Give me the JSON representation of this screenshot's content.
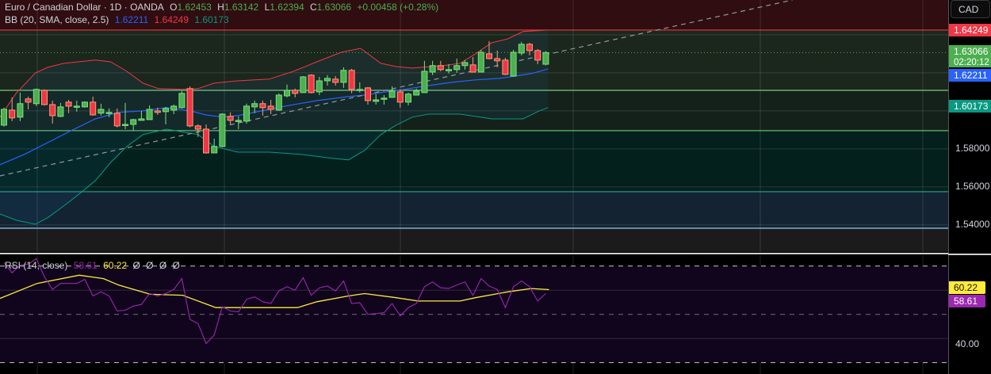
{
  "header": {
    "symbol": "Euro / Canadian Dollar · 1D · OANDA",
    "open_label": "O",
    "open": "1.62453",
    "high_label": "H",
    "high": "1.63142",
    "low_label": "L",
    "low": "1.62394",
    "close_label": "C",
    "close": "1.63066",
    "change": "+0.00458 (+0.28%)"
  },
  "bb_legend": {
    "label": "BB (20, SMA, close, 2.5)",
    "basis": "1.62211",
    "upper": "1.64249",
    "lower": "1.60173"
  },
  "rsi_legend": {
    "label": "RSI (14, close)",
    "rsi": "58.61",
    "ma": "60.22",
    "extras": [
      "Ø",
      "Ø",
      "Ø",
      "Ø"
    ]
  },
  "price_axis": {
    "currency_button": "CAD",
    "ticks": [
      "1.58000",
      "1.56000",
      "1.54000"
    ],
    "upper_badge": "1.64249",
    "last_price_badge": "1.63066",
    "countdown": "02:20:12",
    "basis_badge": "1.62211",
    "lower_badge": "1.60173"
  },
  "rsi_axis": {
    "ticks": [
      "40.00"
    ],
    "ma_badge": "60.22",
    "rsi_badge": "58.61"
  },
  "colors": {
    "up": "#4caf50",
    "down": "#f23645",
    "basis": "#2962ff",
    "upper": "#f23645",
    "lower": "#089981",
    "rsi": "#9c27b0",
    "rsi_ma": "#ffeb3b"
  },
  "chart_data": [
    {
      "type": "candlestick",
      "title": "Euro / Canadian Dollar · 1D · OANDA",
      "ylim": [
        1.5258,
        1.6583
      ],
      "y_ticks": [
        1.54,
        1.56,
        1.58
      ],
      "grid": true,
      "ohlc": [
        [
          1.5925,
          1.6017,
          1.5917,
          1.6008
        ],
        [
          1.6004,
          1.6071,
          1.5946,
          1.5963
        ],
        [
          1.5967,
          1.6096,
          1.5946,
          1.6038
        ],
        [
          1.6063,
          1.6075,
          1.6008,
          1.6046
        ],
        [
          1.6038,
          1.6117,
          1.6025,
          1.6113
        ],
        [
          1.6108,
          1.6113,
          1.6029,
          1.6033
        ],
        [
          1.6033,
          1.6054,
          1.5933,
          1.5975
        ],
        [
          1.5971,
          1.6042,
          1.5967,
          1.6021
        ],
        [
          1.6046,
          1.6058,
          1.5988,
          1.6025
        ],
        [
          1.6025,
          1.6054,
          1.5996,
          1.6025
        ],
        [
          1.6021,
          1.605,
          1.6017,
          1.6046
        ],
        [
          1.6046,
          1.6075,
          1.5975,
          1.5979
        ],
        [
          1.5988,
          1.6038,
          1.5975,
          1.6008
        ],
        [
          1.5992,
          1.6013,
          1.5967,
          1.5992
        ],
        [
          1.5988,
          1.6013,
          1.5913,
          1.5921
        ],
        [
          1.5925,
          1.6042,
          1.5904,
          1.5929
        ],
        [
          1.5929,
          1.5958,
          1.5896,
          1.5954
        ],
        [
          1.595,
          1.6,
          1.595,
          1.5958
        ],
        [
          1.5954,
          1.6029,
          1.5954,
          1.6008
        ],
        [
          1.6,
          1.6017,
          1.5979,
          1.5992
        ],
        [
          1.5996,
          1.6021,
          1.5929,
          1.6013
        ],
        [
          1.6004,
          1.6033,
          1.5983,
          1.6025
        ],
        [
          1.6017,
          1.6104,
          1.6013,
          1.6092
        ],
        [
          1.6117,
          1.6129,
          1.5913,
          1.5921
        ],
        [
          1.5921,
          1.5929,
          1.5863,
          1.5904
        ],
        [
          1.5904,
          1.5929,
          1.5775,
          1.5779
        ],
        [
          1.5779,
          1.5854,
          1.5779,
          1.5813
        ],
        [
          1.5813,
          1.5988,
          1.5808,
          1.5983
        ],
        [
          1.5971,
          1.5992,
          1.5929,
          1.595
        ],
        [
          1.595,
          1.5971,
          1.5904,
          1.595
        ],
        [
          1.5946,
          1.6038,
          1.5933,
          1.6025
        ],
        [
          1.6021,
          1.6054,
          1.5988,
          1.6038
        ],
        [
          1.6038,
          1.6054,
          1.5975,
          1.6017
        ],
        [
          1.6025,
          1.6058,
          1.5983,
          1.6008
        ],
        [
          1.6004,
          1.6092,
          1.6,
          1.6083
        ],
        [
          1.6079,
          1.6138,
          1.6071,
          1.6108
        ],
        [
          1.6108,
          1.6117,
          1.6071,
          1.6092
        ],
        [
          1.6096,
          1.6183,
          1.6096,
          1.6179
        ],
        [
          1.6188,
          1.6192,
          1.6092,
          1.6096
        ],
        [
          1.61,
          1.6179,
          1.6083,
          1.6158
        ],
        [
          1.6158,
          1.6188,
          1.6133,
          1.6171
        ],
        [
          1.6167,
          1.6183,
          1.6133,
          1.615
        ],
        [
          1.615,
          1.6229,
          1.6121,
          1.6213
        ],
        [
          1.6213,
          1.6221,
          1.6092,
          1.6113
        ],
        [
          1.6113,
          1.615,
          1.6096,
          1.6113
        ],
        [
          1.6121,
          1.6125,
          1.6033,
          1.6054
        ],
        [
          1.605,
          1.6088,
          1.6033,
          1.6058
        ],
        [
          1.6067,
          1.6083,
          1.6033,
          1.6067
        ],
        [
          1.6071,
          1.6129,
          1.6071,
          1.6104
        ],
        [
          1.61,
          1.6113,
          1.6017,
          1.6046
        ],
        [
          1.6046,
          1.6096,
          1.6029,
          1.6088
        ],
        [
          1.6083,
          1.6117,
          1.6083,
          1.6104
        ],
        [
          1.6096,
          1.6263,
          1.6096,
          1.6208
        ],
        [
          1.6204,
          1.6263,
          1.6188,
          1.6238
        ],
        [
          1.6238,
          1.6263,
          1.6208,
          1.6217
        ],
        [
          1.6217,
          1.6246,
          1.6196,
          1.6217
        ],
        [
          1.6217,
          1.6275,
          1.62,
          1.6238
        ],
        [
          1.6238,
          1.6267,
          1.6217,
          1.6254
        ],
        [
          1.6242,
          1.6283,
          1.6204,
          1.6204
        ],
        [
          1.6204,
          1.6321,
          1.6204,
          1.6308
        ],
        [
          1.63,
          1.6367,
          1.6271,
          1.6275
        ],
        [
          1.6275,
          1.6317,
          1.6229,
          1.6263
        ],
        [
          1.6267,
          1.6279,
          1.6188,
          1.6192
        ],
        [
          1.6183,
          1.6321,
          1.6179,
          1.6308
        ],
        [
          1.6304,
          1.6363,
          1.6292,
          1.635
        ],
        [
          1.635,
          1.6358,
          1.6292,
          1.6317
        ],
        [
          1.6317,
          1.6325,
          1.6246,
          1.6267
        ],
        [
          1.62453,
          1.63142,
          1.62394,
          1.63066
        ]
      ],
      "bb_upper": [
        [
          -0.5,
          1.5967
        ],
        [
          1.5,
          1.6092
        ],
        [
          3.9,
          1.62
        ],
        [
          5.4,
          1.6229
        ],
        [
          7.4,
          1.625
        ],
        [
          11.3,
          1.6267
        ],
        [
          13.2,
          1.6258
        ],
        [
          15.2,
          1.6208
        ],
        [
          17.2,
          1.6146
        ],
        [
          19.1,
          1.6117
        ],
        [
          22.1,
          1.6113
        ],
        [
          24,
          1.6117
        ],
        [
          26,
          1.6146
        ],
        [
          28.9,
          1.6158
        ],
        [
          32.8,
          1.6167
        ],
        [
          35.8,
          1.6208
        ],
        [
          38.7,
          1.6258
        ],
        [
          41.7,
          1.6308
        ],
        [
          44.1,
          1.6329
        ],
        [
          46.6,
          1.625
        ],
        [
          48.5,
          1.6233
        ],
        [
          50.5,
          1.6225
        ],
        [
          54.4,
          1.6238
        ],
        [
          56.4,
          1.625
        ],
        [
          58.3,
          1.63
        ],
        [
          60.3,
          1.6358
        ],
        [
          62.3,
          1.6379
        ],
        [
          64.2,
          1.6417
        ],
        [
          67.3,
          1.6425
        ]
      ],
      "bb_basis": [
        [
          -0.5,
          1.5717
        ],
        [
          2.5,
          1.5771
        ],
        [
          5.4,
          1.5833
        ],
        [
          8.3,
          1.5896
        ],
        [
          11.3,
          1.5958
        ],
        [
          14.2,
          1.5992
        ],
        [
          17.2,
          1.6
        ],
        [
          20.1,
          1.6017
        ],
        [
          23,
          1.6
        ],
        [
          25,
          1.5979
        ],
        [
          27,
          1.5967
        ],
        [
          28.9,
          1.5975
        ],
        [
          31.9,
          1.6
        ],
        [
          34.8,
          1.6025
        ],
        [
          38.7,
          1.6054
        ],
        [
          42.6,
          1.6075
        ],
        [
          44.6,
          1.6083
        ],
        [
          46.6,
          1.6096
        ],
        [
          49.5,
          1.6113
        ],
        [
          52.5,
          1.6133
        ],
        [
          55.4,
          1.615
        ],
        [
          58.3,
          1.6163
        ],
        [
          61.3,
          1.6171
        ],
        [
          63.2,
          1.6183
        ],
        [
          65.2,
          1.6196
        ],
        [
          67.3,
          1.6221
        ]
      ],
      "bb_lower": [
        [
          -0.5,
          1.5458
        ],
        [
          1.5,
          1.5425
        ],
        [
          3.9,
          1.5404
        ],
        [
          5.4,
          1.5438
        ],
        [
          7.4,
          1.55
        ],
        [
          9.3,
          1.5563
        ],
        [
          11.3,
          1.5633
        ],
        [
          13.2,
          1.5729
        ],
        [
          15.2,
          1.5813
        ],
        [
          17.2,
          1.5875
        ],
        [
          20.1,
          1.5904
        ],
        [
          24,
          1.5875
        ],
        [
          26,
          1.5813
        ],
        [
          28.9,
          1.5783
        ],
        [
          32.8,
          1.5783
        ],
        [
          36.8,
          1.5771
        ],
        [
          40.7,
          1.575
        ],
        [
          42.6,
          1.5742
        ],
        [
          44.6,
          1.5792
        ],
        [
          46.6,
          1.5875
        ],
        [
          48.5,
          1.5925
        ],
        [
          50.5,
          1.5967
        ],
        [
          52.5,
          1.5983
        ],
        [
          56.4,
          1.5983
        ],
        [
          58.3,
          1.5971
        ],
        [
          60.3,
          1.5958
        ],
        [
          64.2,
          1.5958
        ],
        [
          66.2,
          1.6
        ],
        [
          67.3,
          1.6017
        ]
      ],
      "horizontal_levels": [
        {
          "price": 1.64249,
          "color": "#f23645"
        },
        {
          "price": 1.6108,
          "color": "#81c784"
        },
        {
          "price": 1.5896,
          "color": "#66bb6a"
        },
        {
          "price": 1.5575,
          "color": "#26a69a"
        },
        {
          "price": 1.5383,
          "color": "#90caf9"
        }
      ],
      "zones": [
        {
          "from": 1.6583,
          "to": 1.64249,
          "color": "#2f0d10"
        },
        {
          "from": 1.64249,
          "to": 1.6108,
          "color": "#1b261c"
        },
        {
          "from": 1.6108,
          "to": 1.5896,
          "color": "#14211a"
        },
        {
          "from": 1.5896,
          "to": 1.5575,
          "color": "#04201c"
        },
        {
          "from": 1.5575,
          "to": 1.5383,
          "color": "#132331"
        },
        {
          "from": 1.5383,
          "to": 1.5258,
          "color": "#1b1b1b"
        }
      ],
      "trend_line": [
        [
          -0.5,
          1.5658
        ],
        [
          97.5,
          1.6583
        ]
      ],
      "last_price": 1.63066
    },
    {
      "type": "line",
      "title": "RSI (14, close)",
      "ylim": [
        25.3,
        74.5
      ],
      "bands": [
        70,
        50,
        30
      ],
      "grid_levels": [
        60,
        40
      ],
      "rsi": [
        71.4,
        67.2,
        70.3,
        70.7,
        73.1,
        65.5,
        60.3,
        62.8,
        62.8,
        62.8,
        64.5,
        57.6,
        59.3,
        57.6,
        51.4,
        51.7,
        53.4,
        54.1,
        58.6,
        57.6,
        58.6,
        60.3,
        64.8,
        47.9,
        46.2,
        37.9,
        41.4,
        53.1,
        51.4,
        51.0,
        56.2,
        57.2,
        55.2,
        54.5,
        59.7,
        61.4,
        60.0,
        65.2,
        57.9,
        61.0,
        61.7,
        59.7,
        63.8,
        54.5,
        54.8,
        50.0,
        50.3,
        50.7,
        54.5,
        49.3,
        52.8,
        54.5,
        61.4,
        63.4,
        61.0,
        60.7,
        62.1,
        63.4,
        57.9,
        64.8,
        61.7,
        60.3,
        52.8,
        61.4,
        63.8,
        61.4,
        55.5,
        58.61
      ],
      "rsi_ma": [
        [
          -0.5,
          56.6
        ],
        [
          4.1,
          62.8
        ],
        [
          9.3,
          66.2
        ],
        [
          12.3,
          64.8
        ],
        [
          14.2,
          62.1
        ],
        [
          18.1,
          58.3
        ],
        [
          22.1,
          57.9
        ],
        [
          26.2,
          52.8
        ],
        [
          28.9,
          52.8
        ],
        [
          32.8,
          52.8
        ],
        [
          36.3,
          52.8
        ],
        [
          38.7,
          55.2
        ],
        [
          42.6,
          57.6
        ],
        [
          44.6,
          58.6
        ],
        [
          48.5,
          56.9
        ],
        [
          51.2,
          55.5
        ],
        [
          56.4,
          55.5
        ],
        [
          58.3,
          56.9
        ],
        [
          62.3,
          59.3
        ],
        [
          65.2,
          60.7
        ],
        [
          67.4,
          60.22
        ]
      ]
    }
  ]
}
